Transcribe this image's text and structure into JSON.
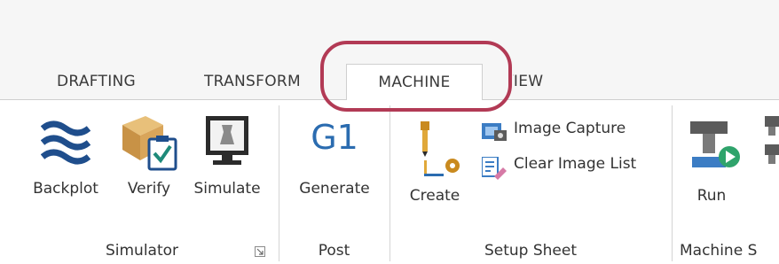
{
  "tabs": [
    "DRAFTING",
    "TRANSFORM",
    "MACHINE",
    "VIEW"
  ],
  "active_tab": "MACHINE",
  "groups": {
    "simulator": {
      "label": "Simulator",
      "buttons": [
        "Backplot",
        "Verify",
        "Simulate"
      ]
    },
    "post": {
      "label": "Post",
      "button": "Generate",
      "icon_text": "G1"
    },
    "setup_sheet": {
      "label": "Setup Sheet",
      "create": "Create",
      "image_capture": "Image Capture",
      "clear_image_list": "Clear Image List"
    },
    "machine_sim": {
      "label": "Machine S",
      "run": "Run"
    }
  },
  "colors": {
    "highlight": "#b23a55",
    "accent": "#2b6cb0",
    "icon_blue": "#1f4e8c"
  }
}
